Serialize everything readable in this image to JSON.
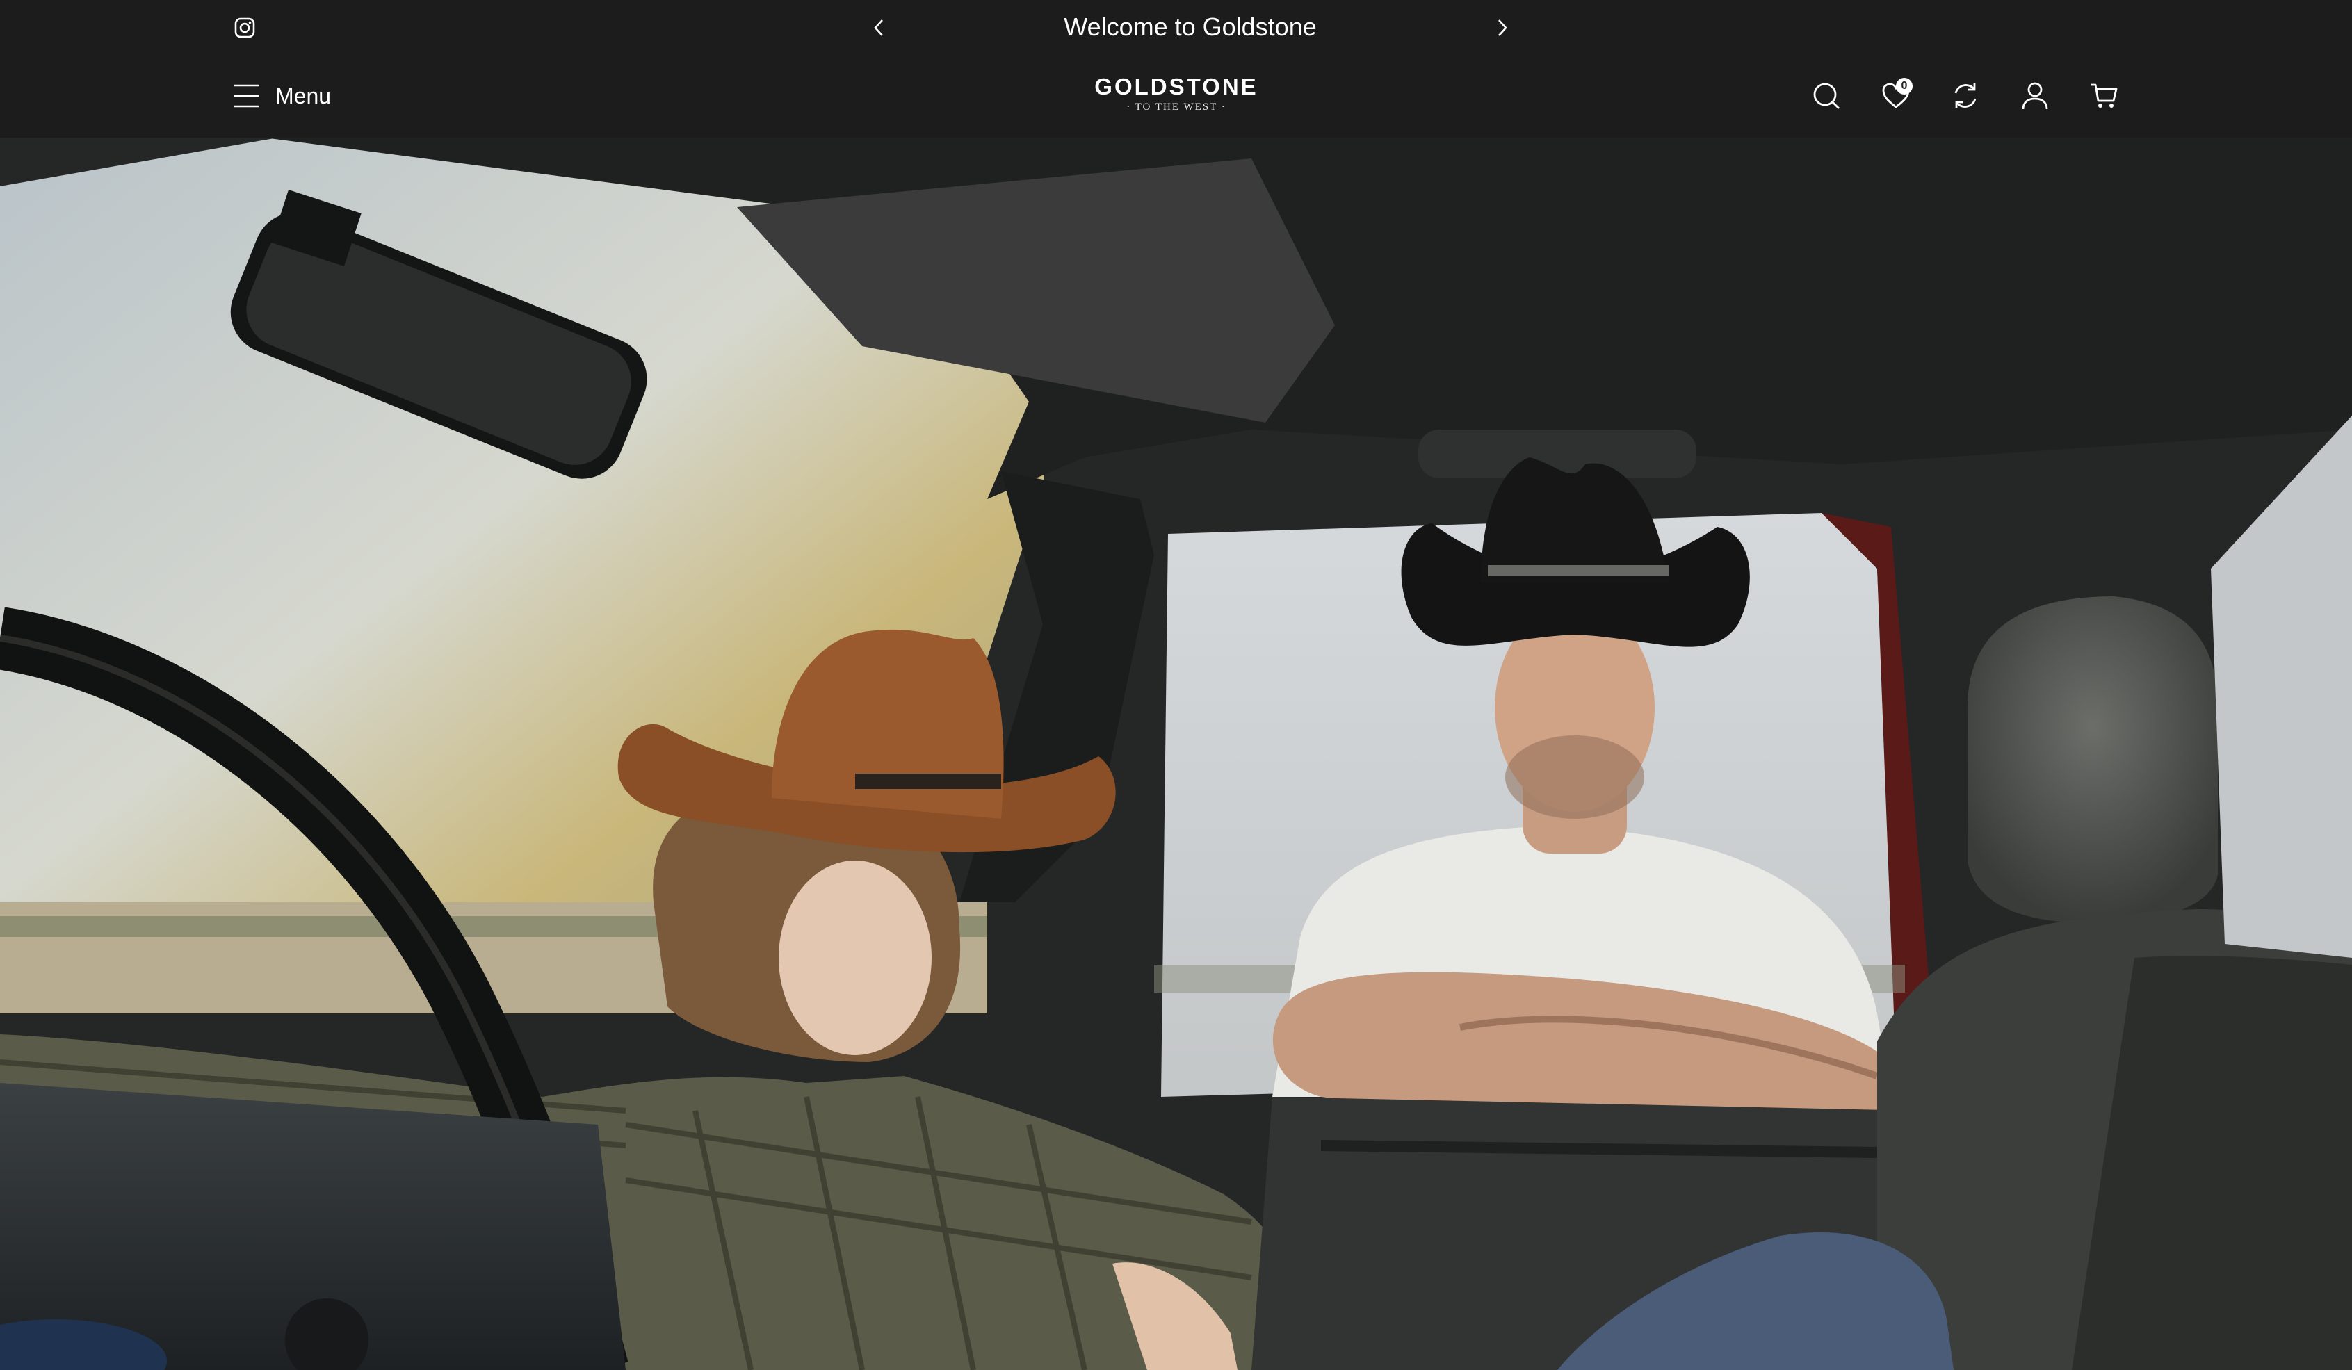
{
  "announcement": {
    "text": "Welcome to Goldstone",
    "prev_icon": "chevron-left-icon",
    "next_icon": "chevron-right-icon",
    "social_icon": "instagram-icon"
  },
  "header": {
    "menu_label": "Menu",
    "logo": {
      "brand": "GOLDSTONE",
      "tagline": "· TO THE WEST ·"
    },
    "icons": {
      "search": "search-icon",
      "wishlist": "heart-icon",
      "compare": "refresh-icon",
      "account": "user-icon",
      "cart": "cart-icon"
    },
    "wishlist_count": "0"
  },
  "colors": {
    "bar_background": "#1c1c1c",
    "text": "#ffffff"
  },
  "hero": {
    "image_description_icon": "hero-photo"
  }
}
